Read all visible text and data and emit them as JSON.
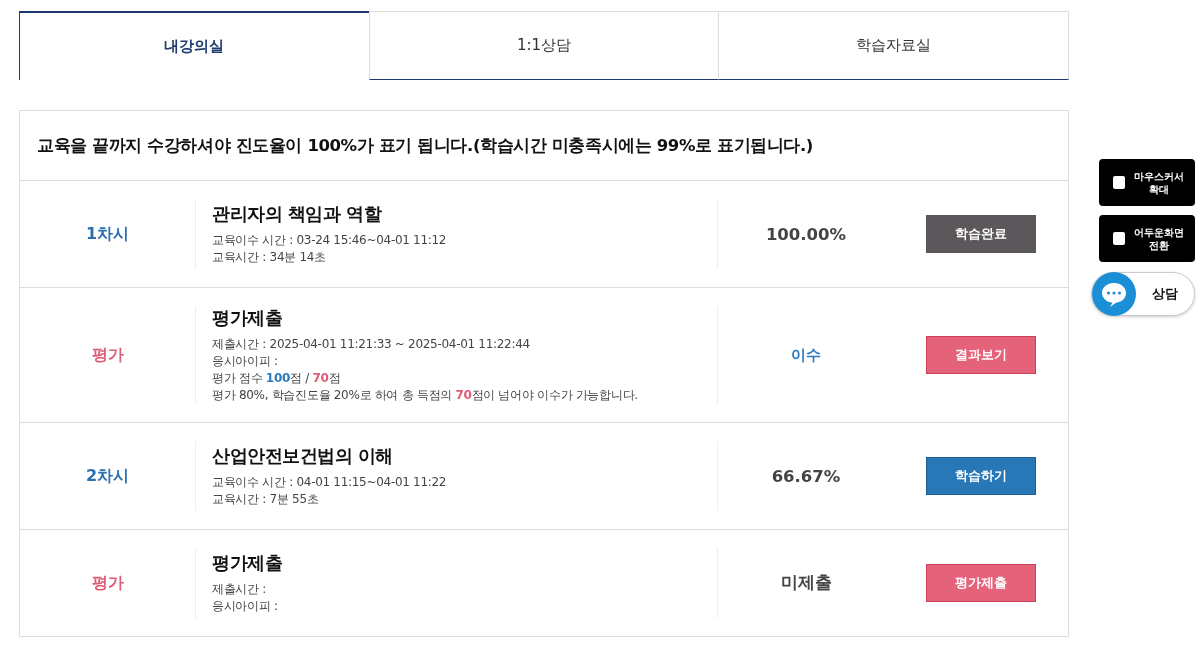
{
  "tabs": [
    {
      "label": "내강의실",
      "selected": true
    },
    {
      "label": "1:1상담",
      "selected": false
    },
    {
      "label": "학습자료실",
      "selected": false
    }
  ],
  "notice": "교육을 끝까지 수강하셔야 진도율이 100%가 표기 됩니다.(학습시간 미충족시에는 99%로 표기됩니다.)",
  "rows": [
    {
      "kind": "lesson",
      "label": "1차시",
      "title": "관리자의 책임과 역할",
      "lines": [
        [
          {
            "text": "교육이수 시간 : 03-24 15:46~04-01 11:12"
          }
        ],
        [
          {
            "text": "교육시간 : 34분 14초"
          }
        ]
      ],
      "status": "100.00%",
      "passed": false,
      "button": {
        "label": "학습완료",
        "kind": "done"
      }
    },
    {
      "kind": "exam",
      "label": "평가",
      "title": "평가제출",
      "lines": [
        [
          {
            "text": "제출시간 : 2025-04-01 11:21:33 ~ 2025-04-01 11:22:44"
          }
        ],
        [
          {
            "text": "응시아이피 :"
          }
        ],
        [
          {
            "text": "평가 점수 "
          },
          {
            "text": "100",
            "color": "#2a7ac0"
          },
          {
            "text": "점 / "
          },
          {
            "text": "70",
            "color": "#e05b75"
          },
          {
            "text": "점"
          }
        ],
        [
          {
            "text": "평가 80%, 학습진도율 20%로 하여 총 득점의 "
          },
          {
            "text": "70",
            "color": "#e05b75"
          },
          {
            "text": "점이 넘어야 이수가 가능합니다."
          }
        ]
      ],
      "status": "이수",
      "passed": true,
      "button": {
        "label": "결과보기",
        "kind": "result"
      }
    },
    {
      "kind": "lesson",
      "label": "2차시",
      "title": "산업안전보건법의 이해",
      "lines": [
        [
          {
            "text": "교육이수 시간 : 04-01 11:15~04-01 11:22"
          }
        ],
        [
          {
            "text": "교육시간 : 7분 55초"
          }
        ]
      ],
      "status": "66.67%",
      "passed": false,
      "button": {
        "label": "학습하기",
        "kind": "study"
      }
    },
    {
      "kind": "exam",
      "label": "평가",
      "title": "평가제출",
      "lines": [
        [
          {
            "text": "제출시간 :"
          }
        ],
        [
          {
            "text": "응시아이피 :"
          }
        ]
      ],
      "status": "미제출",
      "passed": false,
      "button": {
        "label": "평가제출",
        "kind": "submit"
      }
    }
  ],
  "side": {
    "toggles": [
      {
        "label": "마우스커서 확대",
        "checked": false
      },
      {
        "label": "어두운화면 전환",
        "checked": false
      }
    ],
    "chat": "상담"
  }
}
